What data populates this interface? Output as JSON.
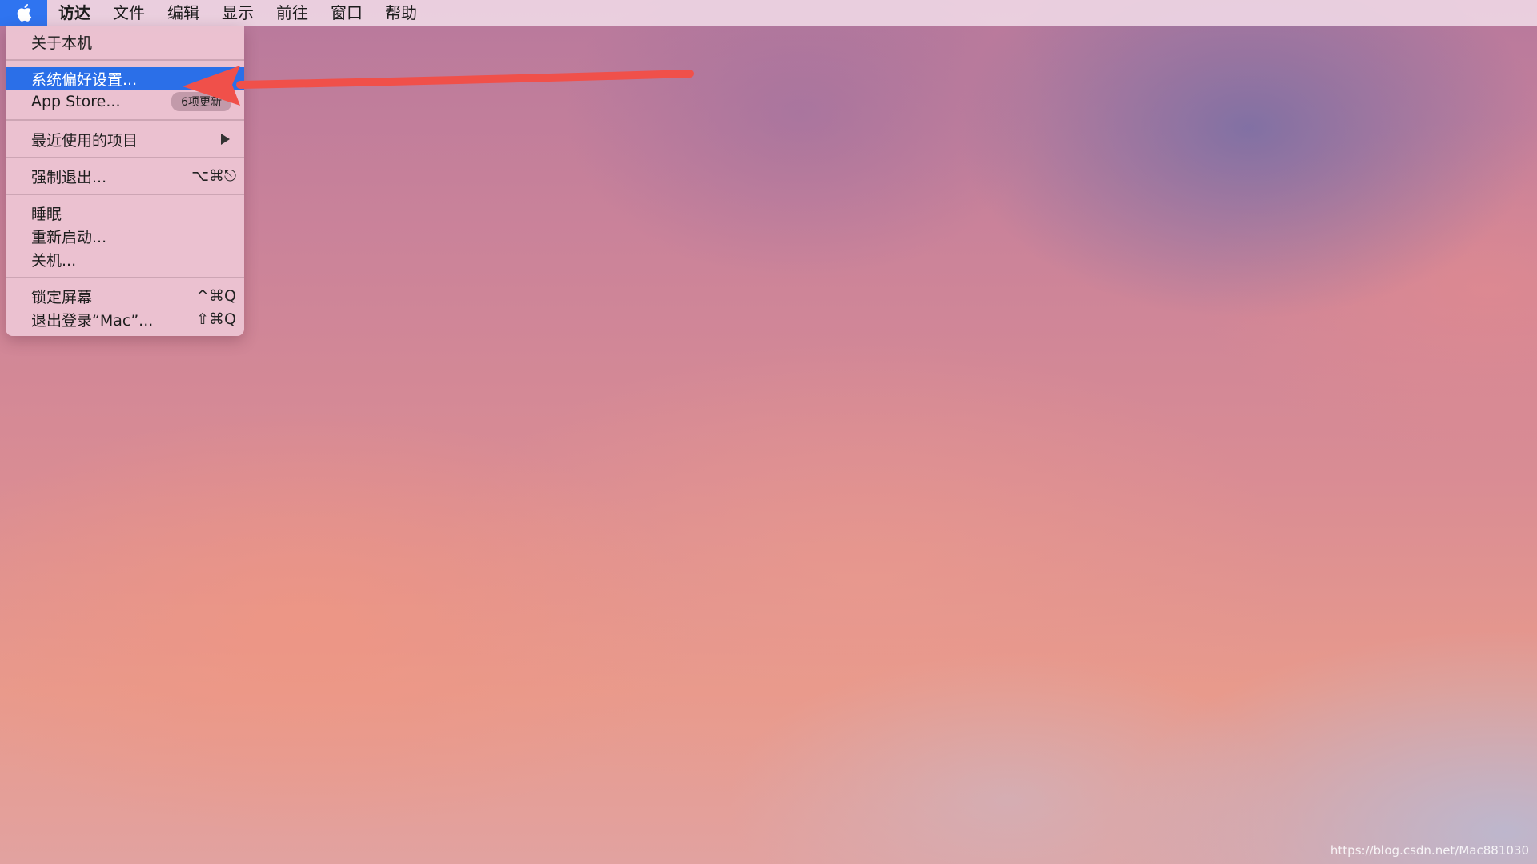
{
  "menubar": {
    "apple_icon": "apple-logo-icon",
    "items": [
      "访达",
      "文件",
      "编辑",
      "显示",
      "前往",
      "窗口",
      "帮助"
    ]
  },
  "apple_menu": {
    "about": "关于本机",
    "system_preferences": "系统偏好设置...",
    "app_store": "App Store...",
    "app_store_badge": "6项更新",
    "recent_items": "最近使用的项目",
    "force_quit": "强制退出...",
    "force_quit_shortcut": "⌥⌘⎋",
    "sleep": "睡眠",
    "restart": "重新启动...",
    "shutdown": "关机...",
    "lock_screen": "锁定屏幕",
    "lock_screen_shortcut": "^⌘Q",
    "logout": "退出登录“Mac”...",
    "logout_shortcut": "⇧⌘Q"
  },
  "annotation": {
    "arrow_color": "#f0504a"
  },
  "watermark": "https://blog.csdn.net/Mac881030",
  "colors": {
    "highlight": "#2b6fe8",
    "apple_button": "#2f74f0"
  }
}
